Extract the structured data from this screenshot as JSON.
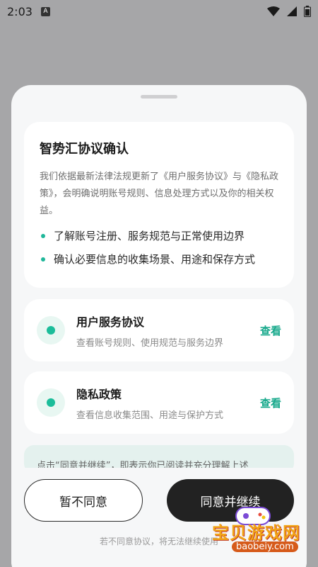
{
  "status_bar": {
    "time": "2:03",
    "a_label": "A",
    "icons": [
      "wifi-icon",
      "signal-icon",
      "battery-icon"
    ]
  },
  "confirm": {
    "title": "智势汇协议确认",
    "description": "我们依据最新法律法规更新了《用户服务协议》与《隐私政策》，会明确说明账号规则、信息处理方式以及你的相关权益。",
    "bullets": [
      "了解账号注册、服务规范与正常使用边界",
      "确认必要信息的收集场景、用途和保存方式"
    ]
  },
  "links": [
    {
      "title": "用户服务协议",
      "subtitle": "查看账号规则、使用规范与服务边界",
      "action": "查看"
    },
    {
      "title": "隐私政策",
      "subtitle": "查看信息收集范围、用途与保护方式",
      "action": "查看"
    }
  ],
  "notice": "点击“同意并继续”，即表示你已阅读并充分理解上述",
  "buttons": {
    "decline": "暂不同意",
    "agree": "同意并继续"
  },
  "footer_note": "若不同意协议，将无法继续使用",
  "watermark": {
    "text": "宝贝游戏网",
    "url": "baobeiy.com"
  },
  "colors": {
    "accent": "#1bbd9a",
    "primary_button": "#222222",
    "backdrop": "#a6a6a8"
  }
}
